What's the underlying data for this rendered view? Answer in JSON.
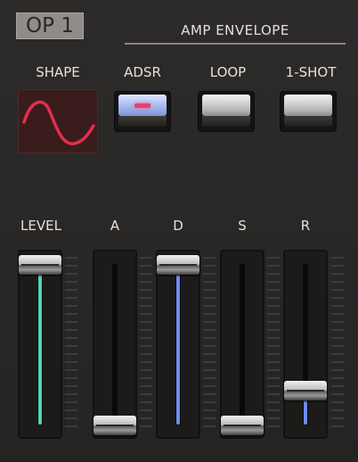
{
  "header": {
    "op_label": "OP 1",
    "section_title": "AMP ENVELOPE"
  },
  "shape": {
    "label": "SHAPE",
    "waveform_icon": "sine-wave-icon",
    "wave_color": "#e0304a"
  },
  "modes": [
    {
      "label": "ADSR",
      "active": true
    },
    {
      "label": "LOOP",
      "active": false
    },
    {
      "label": "1-SHOT",
      "active": false
    }
  ],
  "sliders": [
    {
      "label": "LEVEL",
      "value": 0.98,
      "fill_color": "#4fd6b6"
    },
    {
      "label": "A",
      "value": 0.0,
      "fill_color": null
    },
    {
      "label": "D",
      "value": 0.98,
      "fill_color": "#6f8df0"
    },
    {
      "label": "S",
      "value": 0.0,
      "fill_color": null
    },
    {
      "label": "R",
      "value": 0.21,
      "fill_color": "#6f8df0"
    }
  ]
}
